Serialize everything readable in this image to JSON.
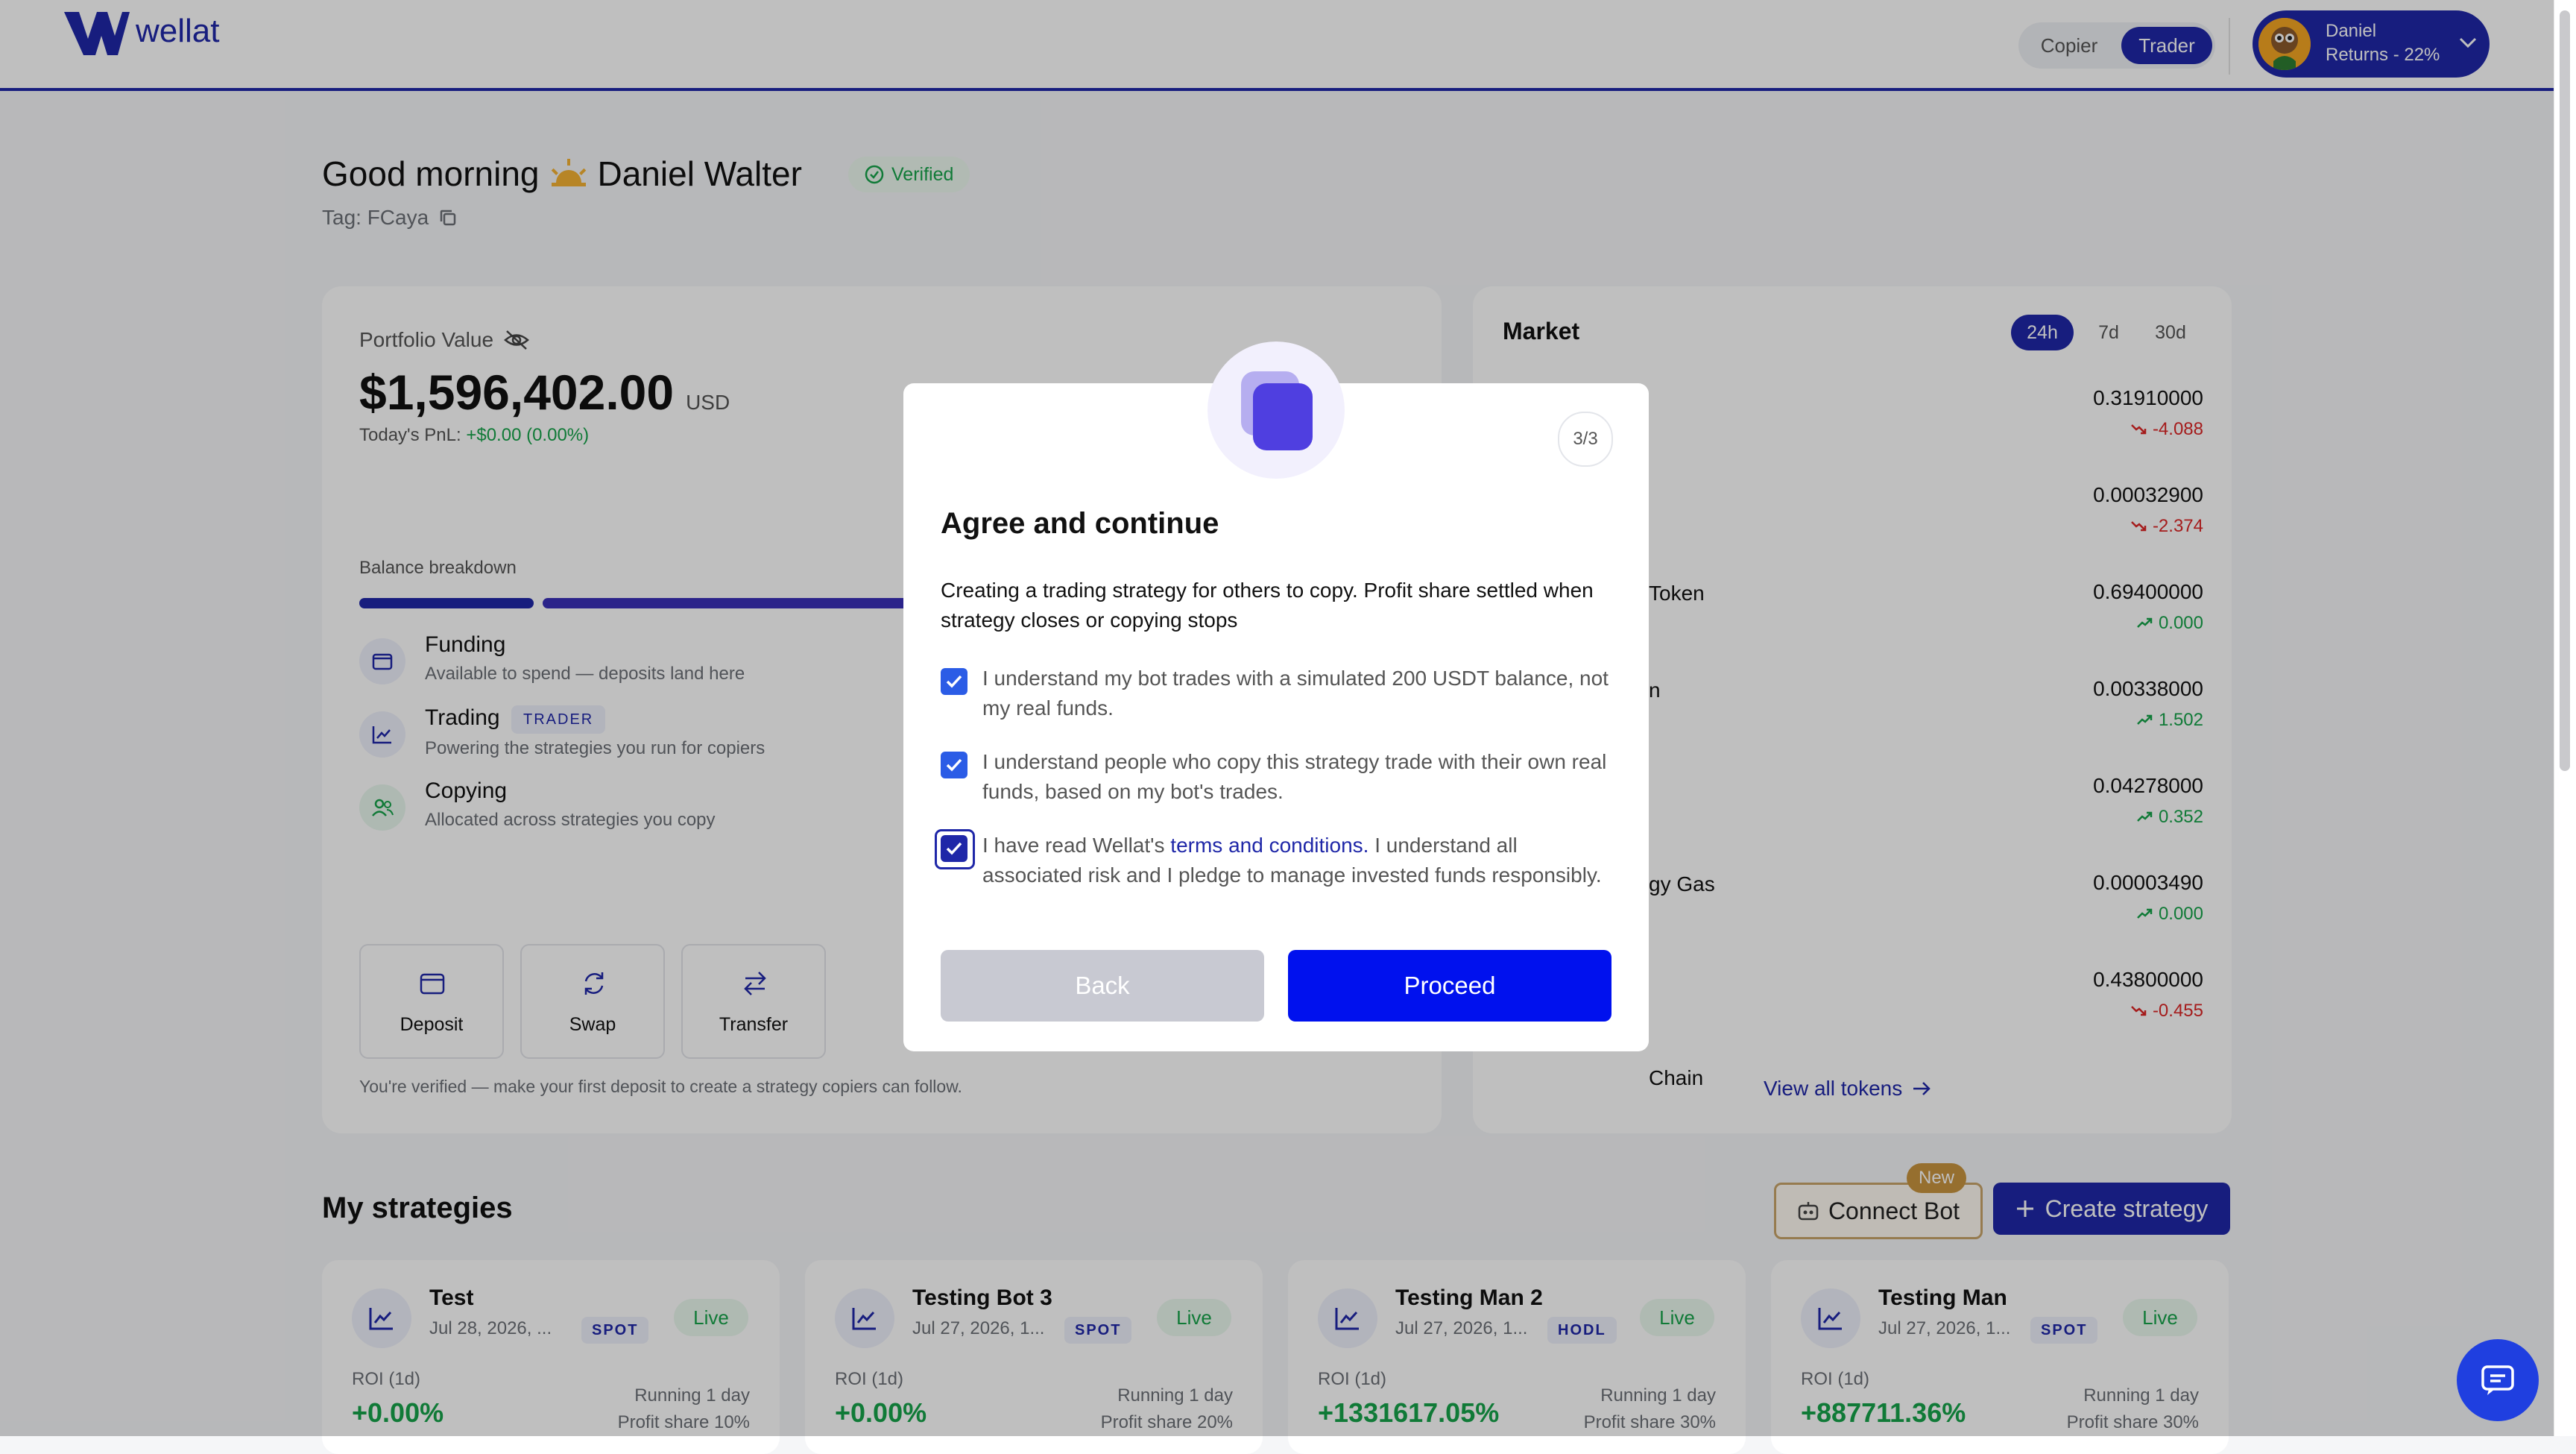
{
  "header": {
    "brand": "wellat",
    "mode_copier": "Copier",
    "mode_trader": "Trader",
    "user_name": "Daniel",
    "user_returns": "Returns - 22%"
  },
  "greeting": {
    "prefix": "Good morning",
    "name": "Daniel Walter",
    "verified": "Verified",
    "tag": "Tag: FCaya"
  },
  "portfolio": {
    "label": "Portfolio Value",
    "value": "$1,596,402.00",
    "currency": "USD",
    "pnl_label": "Today's PnL:",
    "pnl_value": "+$0.00 (0.00%)",
    "breakdown_label": "Balance breakdown",
    "items": [
      {
        "title": "Funding",
        "desc": "Available to spend — deposits land here",
        "badge": ""
      },
      {
        "title": "Trading",
        "desc": "Powering the strategies you run for copiers",
        "badge": "TRADER"
      },
      {
        "title": "Copying",
        "desc": "Allocated across strategies you copy",
        "badge": ""
      }
    ],
    "actions": {
      "deposit": "Deposit",
      "swap": "Swap",
      "transfer": "Transfer"
    },
    "note": "You're verified — make your first deposit to create a strategy copiers can follow."
  },
  "market": {
    "title": "Market",
    "periods": [
      "24h",
      "7d",
      "30d"
    ],
    "rows": [
      {
        "name": "",
        "price": "0.31910000",
        "change": "-4.088",
        "dir": "down"
      },
      {
        "name": "Token",
        "price": "0.00032900",
        "change": "-2.374",
        "dir": "down"
      },
      {
        "name": "n",
        "price": "0.69400000",
        "change": "0.000",
        "dir": "up"
      },
      {
        "name": "",
        "price": "0.00338000",
        "change": "1.502",
        "dir": "up"
      },
      {
        "name": "gy Gas",
        "price": "0.04278000",
        "change": "0.352",
        "dir": "up"
      },
      {
        "name": "",
        "price": "0.00003490",
        "change": "0.000",
        "dir": "up"
      },
      {
        "name": "Chain",
        "price": "0.43800000",
        "change": "-0.455",
        "dir": "down"
      }
    ],
    "view_all": "View all tokens"
  },
  "strategies": {
    "title": "My strategies",
    "connect_bot": "Connect Bot",
    "new_badge": "New",
    "create": "Create strategy",
    "cards": [
      {
        "name": "Test",
        "date": "Jul 28, 2026, ...",
        "type": "SPOT",
        "status": "Live",
        "roi_label": "ROI (1d)",
        "roi": "+0.00%",
        "running": "Running 1 day",
        "share": "Profit share 10%"
      },
      {
        "name": "Testing Bot 3",
        "date": "Jul 27, 2026, 1...",
        "type": "SPOT",
        "status": "Live",
        "roi_label": "ROI (1d)",
        "roi": "+0.00%",
        "running": "Running 1 day",
        "share": "Profit share 20%"
      },
      {
        "name": "Testing Man 2",
        "date": "Jul 27, 2026, 1...",
        "type": "HODL",
        "status": "Live",
        "roi_label": "ROI (1d)",
        "roi": "+1331617.05%",
        "running": "Running 1 day",
        "share": "Profit share 30%"
      },
      {
        "name": "Testing Man",
        "date": "Jul 27, 2026, 1...",
        "type": "SPOT",
        "status": "Live",
        "roi_label": "ROI (1d)",
        "roi": "+887711.36%",
        "running": "Running 1 day",
        "share": "Profit share 30%"
      }
    ]
  },
  "modal": {
    "step": "3/3",
    "title": "Agree and continue",
    "intro": "Creating a trading strategy for others to copy. Profit share settled when strategy closes or copying stops",
    "check1": "I understand my bot trades with a simulated 200 USDT balance, not my real funds.",
    "check2": "I understand people who copy this strategy trade with their own real funds, based on my bot's trades.",
    "check3_pre": "I have read Wellat's",
    "check3_link": "terms and conditions.",
    "check3_post": "I understand all associated risk and I pledge to manage invested funds responsibly.",
    "back": "Back",
    "proceed": "Proceed"
  },
  "colors": {
    "accent": "#1f27a8",
    "primary_button": "#0011ee",
    "verified_green": "#16a34a",
    "up_green": "#16a34a",
    "down_red": "#dc2626",
    "modal_icon": "#4f46e5"
  }
}
